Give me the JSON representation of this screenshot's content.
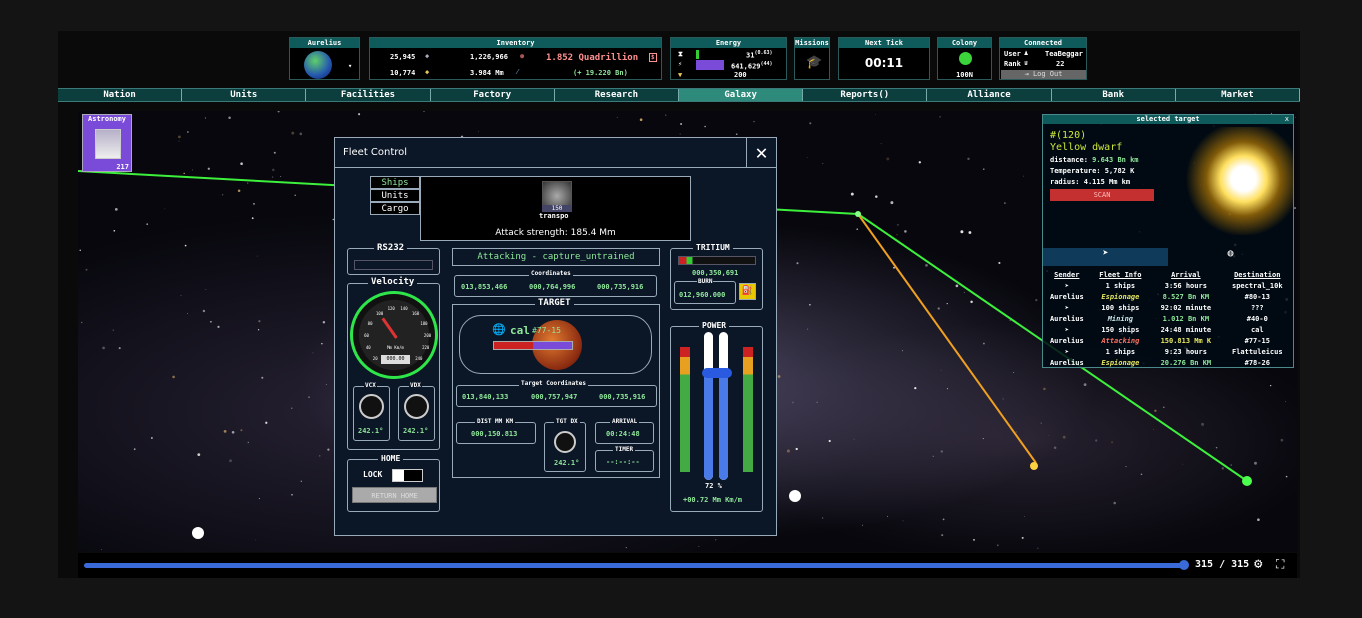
{
  "header": {
    "player": {
      "title": "Aurelius"
    },
    "inventory": {
      "title": "Inventory",
      "r1c1": "25,945",
      "r1c2": "1,226,966",
      "r2c1": "10,774",
      "r2c2": "3.984 Mm",
      "total": "1.852 Quadrillion",
      "delta": "(+ 19.220 Bn)"
    },
    "energy": {
      "title": "Energy",
      "v1": "31",
      "v1sup": "(0.63)",
      "v2": "641,629",
      "v2sup": "(44)",
      "v3": "200"
    },
    "missions": {
      "title": "Missions"
    },
    "next_tick": {
      "title": "Next Tick",
      "value": "00:11"
    },
    "colony": {
      "title": "Colony",
      "value": "100N"
    },
    "connected": {
      "title": "Connected",
      "user_label": "User",
      "user_value": "TeaBeggar",
      "rank_label": "Rank",
      "rank_value": "22",
      "logout": "Log Out"
    }
  },
  "nav": [
    "Nation",
    "Units",
    "Facilities",
    "Factory",
    "Research",
    "Galaxy",
    "Reports()",
    "Alliance",
    "Bank",
    "Market"
  ],
  "nav_active": "Galaxy",
  "astronomy": {
    "label": "Astronomy",
    "count": "217"
  },
  "fleet_control": {
    "title": "Fleet Control",
    "close": "✕",
    "tabs": [
      "Ships",
      "Units",
      "Cargo"
    ],
    "unit_count": "150",
    "unit_name": "transpo",
    "attack_strength": "Attack strength: 185.4 Mm",
    "rs232": "RS232",
    "status": "Attacking - capture_untrained",
    "coordinates_label": "Coordinates",
    "coordinates": [
      "013,853,466",
      "000,764,996",
      "000,735,916"
    ],
    "target_label": "TARGET",
    "target_name": "cal",
    "target_sub": "#77-15",
    "target_coordinates_label": "Target Coordinates",
    "target_coordinates": [
      "013,840,133",
      "000,757,947",
      "000,735,916"
    ],
    "velocity_label": "Velocity",
    "velocity_unit": "Mm Km/m",
    "velocity_value": "000.00",
    "gauge_ticks": [
      "20",
      "40",
      "60",
      "80",
      "100",
      "120",
      "140",
      "160",
      "180",
      "200",
      "220",
      "240"
    ],
    "vcx_label": "VCX",
    "vcx": "242.1°",
    "vdx_label": "VDX",
    "vdx": "242.1°",
    "dist_label": "DIST MM KM",
    "dist": "000,150.813",
    "tgtdx_label": "TGT DX",
    "tgtdx": "242.1°",
    "arrival_label": "ARRIVAL",
    "arrival": "00:24:48",
    "timer_label": "TIMER",
    "timer": "--:--:--",
    "home_label": "HOME",
    "lock_label": "LOCK",
    "return_home": "RETURN HOME",
    "tritium_label": "TRITIUM",
    "tritium_value": "000,350,691",
    "burn_label": "BURN",
    "burn_value": "012,960.000",
    "power_label": "POWER",
    "power_percent": "72 %",
    "power_rate": "+00.72 Mm Km/m",
    "power_level": 0.72
  },
  "selected_target": {
    "title": "selected target",
    "close": "x",
    "id": "#(120)",
    "type": "Yellow dwarf",
    "distance_label": "distance:",
    "distance": "9.643 Bn km",
    "temp_label": "Temperature:",
    "temp": "5,782 K",
    "radius_label": "radius:",
    "radius": "4.115 Mm km",
    "scan": "SCAN",
    "columns": [
      "Sender",
      "Fleet Info",
      "Arrival",
      "Destination"
    ],
    "rows": [
      {
        "sender": "",
        "info": "1 ships",
        "arrival": "3:56 hours",
        "dest": "spectral_10k"
      },
      {
        "sender": "Aurelius",
        "info": "Espionage",
        "arrival": "8.527 Bn KM",
        "dest": "#80-13",
        "mode": "esp"
      },
      {
        "sender": "",
        "info": "100 ships",
        "arrival": "92:02 minute",
        "dest": "???"
      },
      {
        "sender": "Aurelius",
        "info": "Mining",
        "arrival": "1.012 Bn KM",
        "dest": "#40-0",
        "mode": "mine"
      },
      {
        "sender": "",
        "info": "150 ships",
        "arrival": "24:48 minute",
        "dest": "cal"
      },
      {
        "sender": "Aurelius",
        "info": "Attacking",
        "arrival": "150.813 Mm K",
        "dest": "#77-15",
        "mode": "atk"
      },
      {
        "sender": "",
        "info": "1 ships",
        "arrival": "9:23 hours",
        "dest": "Flattuleicus"
      },
      {
        "sender": "Aurelius",
        "info": "Espionage",
        "arrival": "20.276 Bn KM",
        "dest": "#78-26",
        "mode": "esp"
      }
    ]
  },
  "progress": {
    "label": "315 / 315",
    "fraction": 1.0
  }
}
